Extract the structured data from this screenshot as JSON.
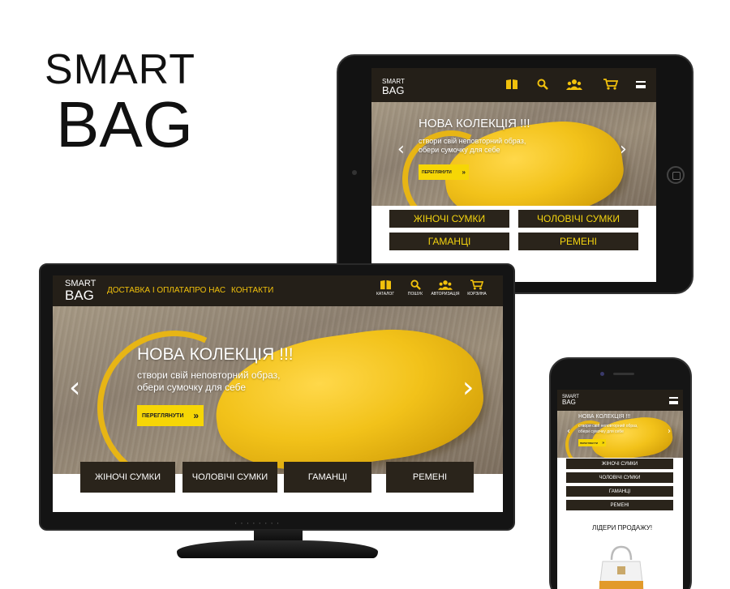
{
  "logo": {
    "line1": "SMART",
    "line2": "BAG"
  },
  "site": {
    "brand_top": "SMART",
    "brand_bottom": "BAG",
    "menu": [
      "ДОСТАВКА І ОПЛАТА",
      "ПРО НАС",
      "КОНТАКТИ"
    ],
    "icons": [
      {
        "name": "catalog-icon",
        "label": "КАТАЛОГ"
      },
      {
        "name": "search-icon",
        "label": "ПОШУК"
      },
      {
        "name": "users-icon",
        "label": "АВТОРИЗАЦІЯ"
      },
      {
        "name": "cart-icon",
        "label": "КОРЗИНА"
      }
    ],
    "hero": {
      "title": "НОВА КОЛЕКЦІЯ !!!",
      "subtitle_line1": "створи свій неповторний образ,",
      "subtitle_line2": "обери сумочку для себе",
      "button": "ПЕРЕГЛЯНУТИ",
      "button_icon": "double-chevron-right-icon",
      "prev_arrow": "‹",
      "next_arrow": "›"
    },
    "categories": [
      "ЖІНОЧІ СУМКИ",
      "ЧОЛОВІЧІ СУМКИ",
      "ГАМАНЦІ",
      "РЕМЕНІ"
    ],
    "leaders": "ЛІДЕРИ ПРОДАЖУ!"
  },
  "colors": {
    "header": "#241f18",
    "accent": "#f6d606",
    "category_bg": "#2a241b",
    "category_text": "#f4d40f"
  }
}
